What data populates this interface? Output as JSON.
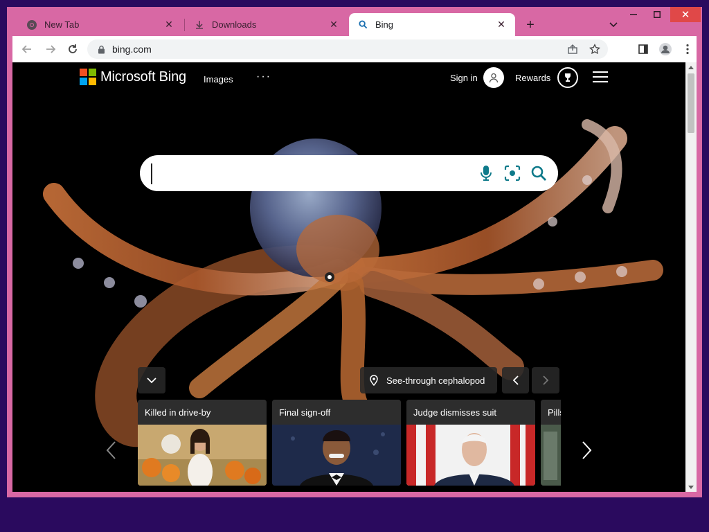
{
  "browser": {
    "tabs": [
      {
        "label": "New Tab",
        "icon": "chrome-icon"
      },
      {
        "label": "Downloads",
        "icon": "download-icon"
      },
      {
        "label": "Bing",
        "icon": "search-icon",
        "active": true
      }
    ],
    "url": "bing.com"
  },
  "bing": {
    "logo_text": "Microsoft Bing",
    "nav": {
      "images": "Images",
      "more": "···"
    },
    "signin_label": "Sign in",
    "rewards_label": "Rewards",
    "search": {
      "value": "",
      "placeholder": ""
    },
    "image_caption": "See-through cephalopod",
    "news": [
      {
        "title": "Killed in drive-by"
      },
      {
        "title": "Final sign-off"
      },
      {
        "title": "Judge dismisses suit"
      },
      {
        "title": "Pills"
      }
    ]
  },
  "colors": {
    "window_frame": "#d868a4",
    "desktop": "#2a0a5e",
    "bing_teal": "#0e7a8a",
    "close_red": "#e04848"
  }
}
